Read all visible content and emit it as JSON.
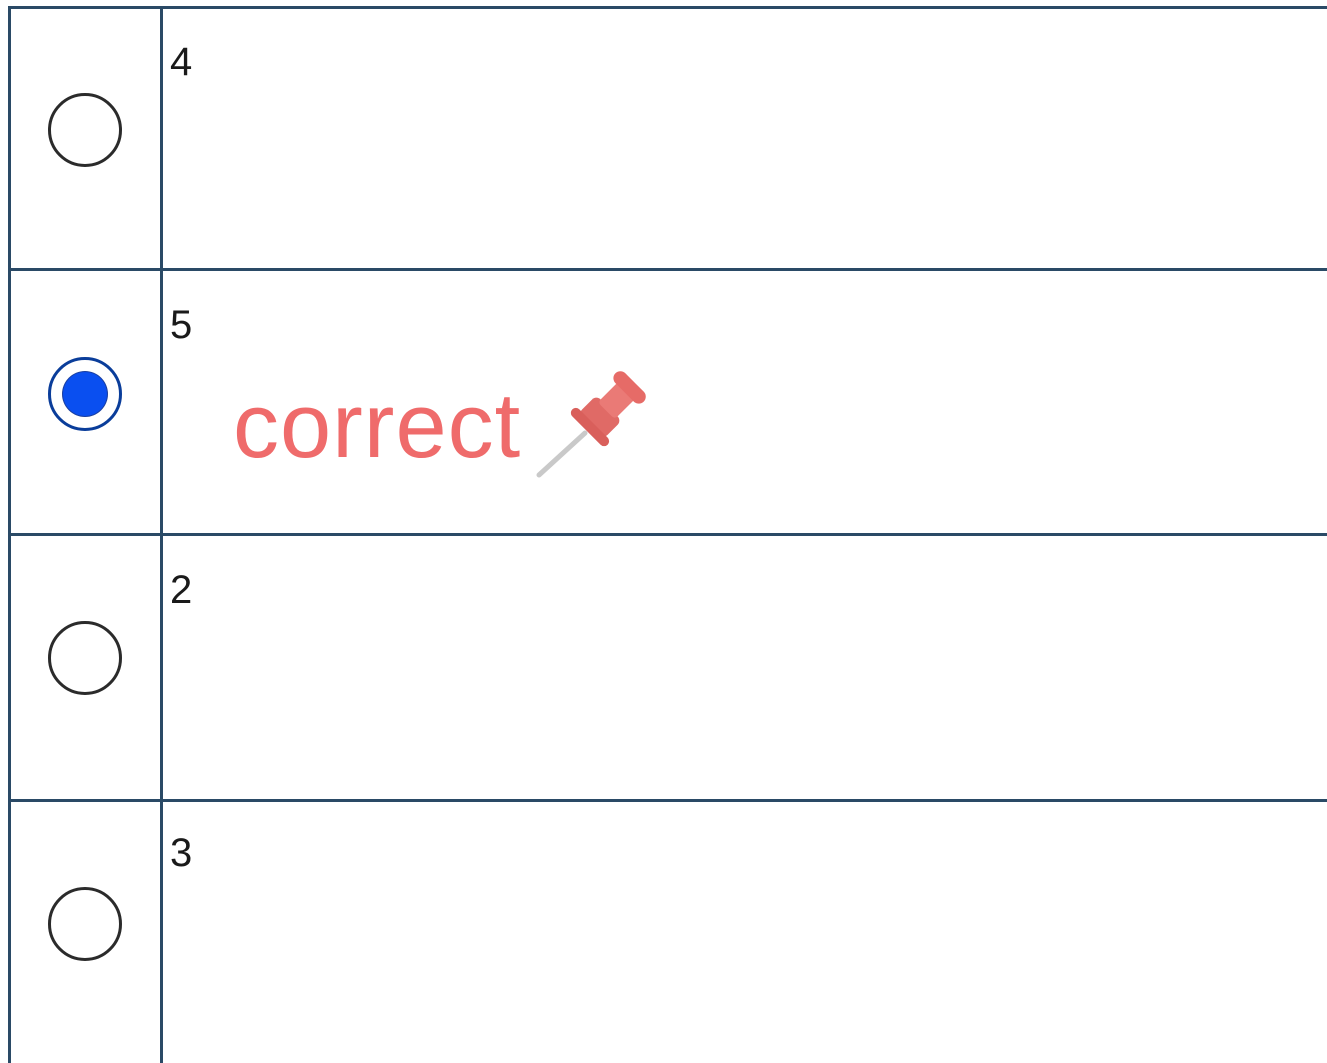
{
  "options": [
    {
      "label": "4",
      "selected": false
    },
    {
      "label": "5",
      "selected": true
    },
    {
      "label": "2",
      "selected": false
    },
    {
      "label": "3",
      "selected": false
    }
  ],
  "annotation": {
    "text": "correct",
    "icon": "pushpin-icon",
    "color": "#ef6b6b"
  },
  "colors": {
    "border": "#2a4a66",
    "radio_selected": "#0a4ff0"
  }
}
